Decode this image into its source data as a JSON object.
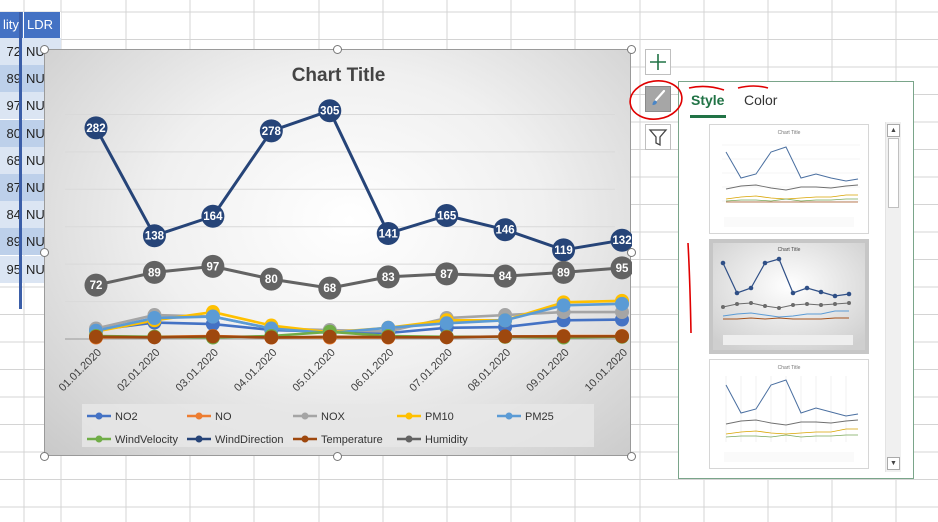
{
  "sheet": {
    "headers": [
      "lity",
      "LDR"
    ],
    "rows": [
      {
        "a": "72",
        "b": "NU"
      },
      {
        "a": "89",
        "b": "NU"
      },
      {
        "a": "97",
        "b": "NU"
      },
      {
        "a": "80",
        "b": "NU"
      },
      {
        "a": "68",
        "b": "NU"
      },
      {
        "a": "87",
        "b": "NU"
      },
      {
        "a": "84",
        "b": "NU"
      },
      {
        "a": "89",
        "b": "NU"
      },
      {
        "a": "95",
        "b": "NU"
      }
    ]
  },
  "chart_buttons": {
    "elements_icon": "plus-icon",
    "styles_icon": "paintbrush-icon",
    "filters_icon": "funnel-icon"
  },
  "style_pane": {
    "tabs": [
      "Style",
      "Color"
    ],
    "active_tab": "Style",
    "selected_thumbnail": 2,
    "accent_color": "#217346"
  },
  "annotations": {
    "color": "#e00000"
  },
  "chart_data": {
    "type": "line",
    "title": "Chart Title",
    "categories": [
      "01.01.2020",
      "02.01.2020",
      "03.01.2020",
      "04.01.2020",
      "05.01.2020",
      "06.01.2020",
      "07.01.2020",
      "08.01.2020",
      "09.01.2020",
      "10.01.2020"
    ],
    "ylim": [
      0,
      330
    ],
    "gridlines": true,
    "legend_position": "bottom",
    "data_labels": true,
    "series": [
      {
        "name": "NO2",
        "color": "#4472c4",
        "values": [
          12,
          22,
          20,
          12,
          10,
          8,
          15,
          16,
          25,
          26
        ],
        "show_labels": false
      },
      {
        "name": "NO",
        "color": "#ed7d31",
        "values": [
          2,
          3,
          4,
          2,
          2,
          2,
          3,
          3,
          4,
          4
        ],
        "show_labels": false
      },
      {
        "name": "NOX",
        "color": "#a5a5a5",
        "values": [
          14,
          32,
          30,
          14,
          12,
          10,
          28,
          32,
          36,
          36
        ],
        "show_labels": false
      },
      {
        "name": "PM10",
        "color": "#ffc000",
        "values": [
          10,
          25,
          36,
          18,
          9,
          15,
          25,
          25,
          49,
          51
        ],
        "show_labels": false
      },
      {
        "name": "PM25",
        "color": "#5b9bd5",
        "values": [
          11,
          28,
          30,
          14,
          8,
          15,
          21,
          25,
          45,
          47
        ],
        "show_labels": false
      },
      {
        "name": "WindVelocity",
        "color": "#70ad47",
        "values": [
          4,
          3,
          2,
          4,
          9.61,
          4,
          3,
          3,
          2,
          3
        ],
        "show_labels": false
      },
      {
        "name": "WindDirection",
        "color": "#264478",
        "values": [
          282,
          138,
          164,
          278,
          305,
          141,
          165,
          146,
          119,
          132
        ],
        "show_labels": true
      },
      {
        "name": "Temperature",
        "color": "#9e480e",
        "values": [
          2.9,
          2.22,
          3.52,
          2.1,
          2.96,
          2.5,
          2.2,
          3.43,
          3.5,
          3.58
        ],
        "show_labels": false
      },
      {
        "name": "Humidity",
        "color": "#636363",
        "values": [
          72,
          89,
          97,
          80,
          68,
          83,
          87,
          84,
          89,
          95
        ],
        "show_labels": true
      }
    ]
  }
}
